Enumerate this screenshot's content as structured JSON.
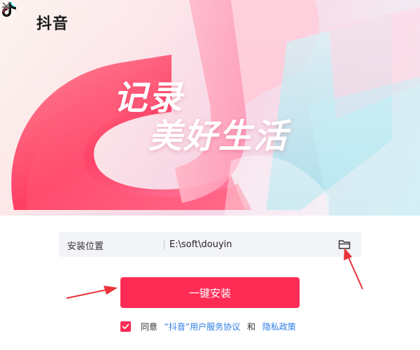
{
  "app": {
    "title": "抖音"
  },
  "hero": {
    "slogan_line1": "记录",
    "slogan_line2": "美好生活"
  },
  "install_path": {
    "label": "安装位置",
    "value": "E:\\soft\\douyin"
  },
  "install_button": {
    "label": "一键安装"
  },
  "agreement": {
    "checked": true,
    "prefix": "同意",
    "user_agreement_link": "“抖音”用户服务协议",
    "conjunction": "和",
    "privacy_link": "隐私政策"
  },
  "colors": {
    "accent": "#fe2c55",
    "link": "#2c7ee6",
    "annotation_arrow": "#e8333b"
  },
  "icons": [
    "douyin-logo-icon",
    "minimize-icon",
    "close-icon",
    "folder-icon",
    "checkbox-checked-icon"
  ]
}
